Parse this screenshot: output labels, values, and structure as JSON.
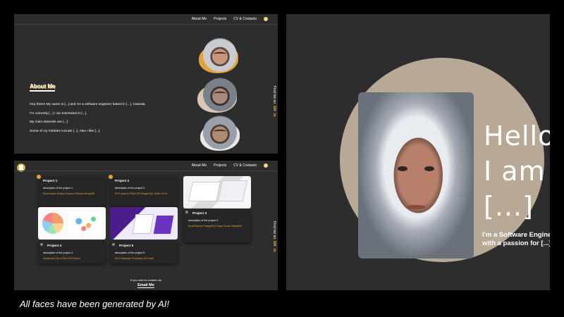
{
  "nav": {
    "about": "About Me",
    "projects": "Projects",
    "cv": "CV & Contacts"
  },
  "side": {
    "find_me": "Find me on",
    "github": "GH",
    "linkedin": "in"
  },
  "about": {
    "title": "About Me",
    "line1": "Hey there! My name is [...] and I'm a software engineer based in [...], Canada.",
    "line2": "I'm currently [...] I am interested in [...].",
    "line3": "My main interests are [...].",
    "line4": "Some of my hobbies include [...]. Also I like [...]."
  },
  "projects": [
    {
      "title": "Project 1",
      "desc": "description of the project 1.",
      "tags": "React Native   Node.js   Express   Firebase   MongoDB"
    },
    {
      "title": "Project 2",
      "desc": "description of the project 2.",
      "tags": "PHP   Laravel   HTML/CSS   PostgreSQL   Gitlab CI/CD"
    },
    {
      "title": "Project 3",
      "desc": "description of the project 3.",
      "tags": "Node/Express   PostgreSQL   React   Docker   MaterialUI"
    },
    {
      "title": "Project 4",
      "desc": "description of the project 4.",
      "tags": "JavaScript   D3.js   HTML/CSS   Python"
    },
    {
      "title": "Project 5",
      "desc": "description of the project 5.",
      "tags": "UI/UX   Illustrator   Photoshop   XD   React"
    }
  ],
  "contact": {
    "text": "If you wish to contact me",
    "email": "Email Me"
  },
  "hero": {
    "line1": "Hello",
    "line2": "I am",
    "line3": "[...]",
    "tagline": "I'm a Software Engineer with a passion for [...]."
  },
  "caption": "All faces have been generated by AI!",
  "colors": {
    "background": "#2d2d2d",
    "accent": "#e2a43a",
    "hero_circle": "#b8a896"
  }
}
